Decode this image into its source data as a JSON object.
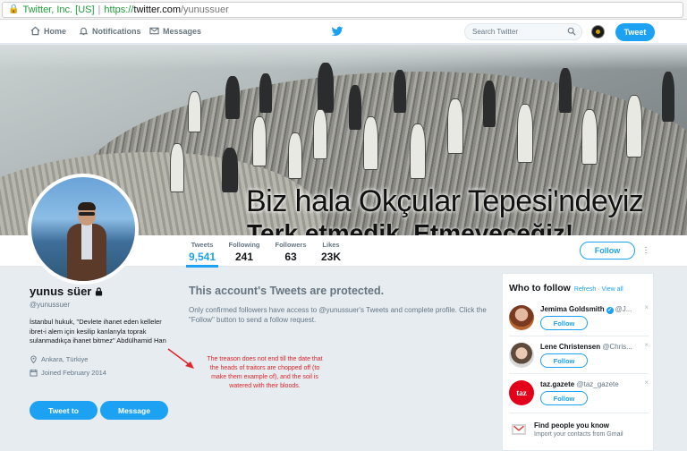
{
  "browser": {
    "org": "Twitter, Inc. [US]",
    "scheme": "https://",
    "host": "twitter.com",
    "path": "/yunussuer"
  },
  "nav": {
    "home": "Home",
    "notifications": "Notifications",
    "messages": "Messages",
    "search_placeholder": "Search Twitter",
    "tweet_button": "Tweet"
  },
  "banner": {
    "line1": "Biz hala Okçular Tepesi'ndeyiz",
    "line2": "Terk etmedik. Etmeyeceğiz!"
  },
  "stats": [
    {
      "label": "Tweets",
      "value": "9,541"
    },
    {
      "label": "Following",
      "value": "241"
    },
    {
      "label": "Followers",
      "value": "63"
    },
    {
      "label": "Likes",
      "value": "23K"
    }
  ],
  "follow_button": "Follow",
  "profile": {
    "name": "yunus süer",
    "handle": "@yunussuer",
    "bio": "İstanbul hukuk, \"Devlete ihanet eden kelleler ibret-i alem için kesilip kanlarıyla toprak sulanmadıkça ihanet bitmez\" Abdülhamid Han",
    "location": "Ankara, Türkiye",
    "joined": "Joined February 2014",
    "tweet_to": "Tweet to",
    "message": "Message"
  },
  "protected": {
    "title": "This account's Tweets are protected.",
    "body": "Only confirmed followers have access to @yunussuer's Tweets and complete profile. Click the \"Follow\" button to send a follow request."
  },
  "annotation": "The treason does not end till the date that the heads of traitors are chopped off (to make them example of), and the soil is watered with their bloods.",
  "who_to_follow": {
    "title": "Who to follow",
    "refresh": "Refresh",
    "separator": "·",
    "view_all": "View all",
    "suggestions": [
      {
        "name": "Jemima Goldsmith",
        "handle": "@J...",
        "verified": true,
        "button": "Follow"
      },
      {
        "name": "Lene Christensen",
        "handle": "@Chris...",
        "verified": false,
        "button": "Follow"
      },
      {
        "name": "taz.gazete",
        "handle": "@taz_gazete",
        "verified": false,
        "button": "Follow"
      }
    ],
    "find_title": "Find people you know",
    "find_sub": "Import your contacts from Gmail",
    "dismiss": "×",
    "avatar_text": "taz"
  },
  "colors": {
    "accent": "#1da1f2",
    "annotation": "#e0262b",
    "background": "#e6ecf0"
  }
}
